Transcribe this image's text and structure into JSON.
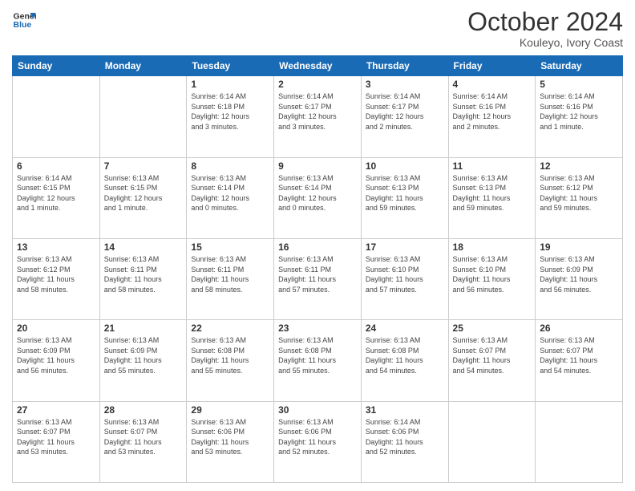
{
  "logo": {
    "line1": "General",
    "line2": "Blue"
  },
  "header": {
    "month": "October 2024",
    "location": "Kouleyo, Ivory Coast"
  },
  "weekdays": [
    "Sunday",
    "Monday",
    "Tuesday",
    "Wednesday",
    "Thursday",
    "Friday",
    "Saturday"
  ],
  "weeks": [
    [
      {
        "day": "",
        "info": ""
      },
      {
        "day": "",
        "info": ""
      },
      {
        "day": "1",
        "info": "Sunrise: 6:14 AM\nSunset: 6:18 PM\nDaylight: 12 hours\nand 3 minutes."
      },
      {
        "day": "2",
        "info": "Sunrise: 6:14 AM\nSunset: 6:17 PM\nDaylight: 12 hours\nand 3 minutes."
      },
      {
        "day": "3",
        "info": "Sunrise: 6:14 AM\nSunset: 6:17 PM\nDaylight: 12 hours\nand 2 minutes."
      },
      {
        "day": "4",
        "info": "Sunrise: 6:14 AM\nSunset: 6:16 PM\nDaylight: 12 hours\nand 2 minutes."
      },
      {
        "day": "5",
        "info": "Sunrise: 6:14 AM\nSunset: 6:16 PM\nDaylight: 12 hours\nand 1 minute."
      }
    ],
    [
      {
        "day": "6",
        "info": "Sunrise: 6:14 AM\nSunset: 6:15 PM\nDaylight: 12 hours\nand 1 minute."
      },
      {
        "day": "7",
        "info": "Sunrise: 6:13 AM\nSunset: 6:15 PM\nDaylight: 12 hours\nand 1 minute."
      },
      {
        "day": "8",
        "info": "Sunrise: 6:13 AM\nSunset: 6:14 PM\nDaylight: 12 hours\nand 0 minutes."
      },
      {
        "day": "9",
        "info": "Sunrise: 6:13 AM\nSunset: 6:14 PM\nDaylight: 12 hours\nand 0 minutes."
      },
      {
        "day": "10",
        "info": "Sunrise: 6:13 AM\nSunset: 6:13 PM\nDaylight: 11 hours\nand 59 minutes."
      },
      {
        "day": "11",
        "info": "Sunrise: 6:13 AM\nSunset: 6:13 PM\nDaylight: 11 hours\nand 59 minutes."
      },
      {
        "day": "12",
        "info": "Sunrise: 6:13 AM\nSunset: 6:12 PM\nDaylight: 11 hours\nand 59 minutes."
      }
    ],
    [
      {
        "day": "13",
        "info": "Sunrise: 6:13 AM\nSunset: 6:12 PM\nDaylight: 11 hours\nand 58 minutes."
      },
      {
        "day": "14",
        "info": "Sunrise: 6:13 AM\nSunset: 6:11 PM\nDaylight: 11 hours\nand 58 minutes."
      },
      {
        "day": "15",
        "info": "Sunrise: 6:13 AM\nSunset: 6:11 PM\nDaylight: 11 hours\nand 58 minutes."
      },
      {
        "day": "16",
        "info": "Sunrise: 6:13 AM\nSunset: 6:11 PM\nDaylight: 11 hours\nand 57 minutes."
      },
      {
        "day": "17",
        "info": "Sunrise: 6:13 AM\nSunset: 6:10 PM\nDaylight: 11 hours\nand 57 minutes."
      },
      {
        "day": "18",
        "info": "Sunrise: 6:13 AM\nSunset: 6:10 PM\nDaylight: 11 hours\nand 56 minutes."
      },
      {
        "day": "19",
        "info": "Sunrise: 6:13 AM\nSunset: 6:09 PM\nDaylight: 11 hours\nand 56 minutes."
      }
    ],
    [
      {
        "day": "20",
        "info": "Sunrise: 6:13 AM\nSunset: 6:09 PM\nDaylight: 11 hours\nand 56 minutes."
      },
      {
        "day": "21",
        "info": "Sunrise: 6:13 AM\nSunset: 6:09 PM\nDaylight: 11 hours\nand 55 minutes."
      },
      {
        "day": "22",
        "info": "Sunrise: 6:13 AM\nSunset: 6:08 PM\nDaylight: 11 hours\nand 55 minutes."
      },
      {
        "day": "23",
        "info": "Sunrise: 6:13 AM\nSunset: 6:08 PM\nDaylight: 11 hours\nand 55 minutes."
      },
      {
        "day": "24",
        "info": "Sunrise: 6:13 AM\nSunset: 6:08 PM\nDaylight: 11 hours\nand 54 minutes."
      },
      {
        "day": "25",
        "info": "Sunrise: 6:13 AM\nSunset: 6:07 PM\nDaylight: 11 hours\nand 54 minutes."
      },
      {
        "day": "26",
        "info": "Sunrise: 6:13 AM\nSunset: 6:07 PM\nDaylight: 11 hours\nand 54 minutes."
      }
    ],
    [
      {
        "day": "27",
        "info": "Sunrise: 6:13 AM\nSunset: 6:07 PM\nDaylight: 11 hours\nand 53 minutes."
      },
      {
        "day": "28",
        "info": "Sunrise: 6:13 AM\nSunset: 6:07 PM\nDaylight: 11 hours\nand 53 minutes."
      },
      {
        "day": "29",
        "info": "Sunrise: 6:13 AM\nSunset: 6:06 PM\nDaylight: 11 hours\nand 53 minutes."
      },
      {
        "day": "30",
        "info": "Sunrise: 6:13 AM\nSunset: 6:06 PM\nDaylight: 11 hours\nand 52 minutes."
      },
      {
        "day": "31",
        "info": "Sunrise: 6:14 AM\nSunset: 6:06 PM\nDaylight: 11 hours\nand 52 minutes."
      },
      {
        "day": "",
        "info": ""
      },
      {
        "day": "",
        "info": ""
      }
    ]
  ]
}
